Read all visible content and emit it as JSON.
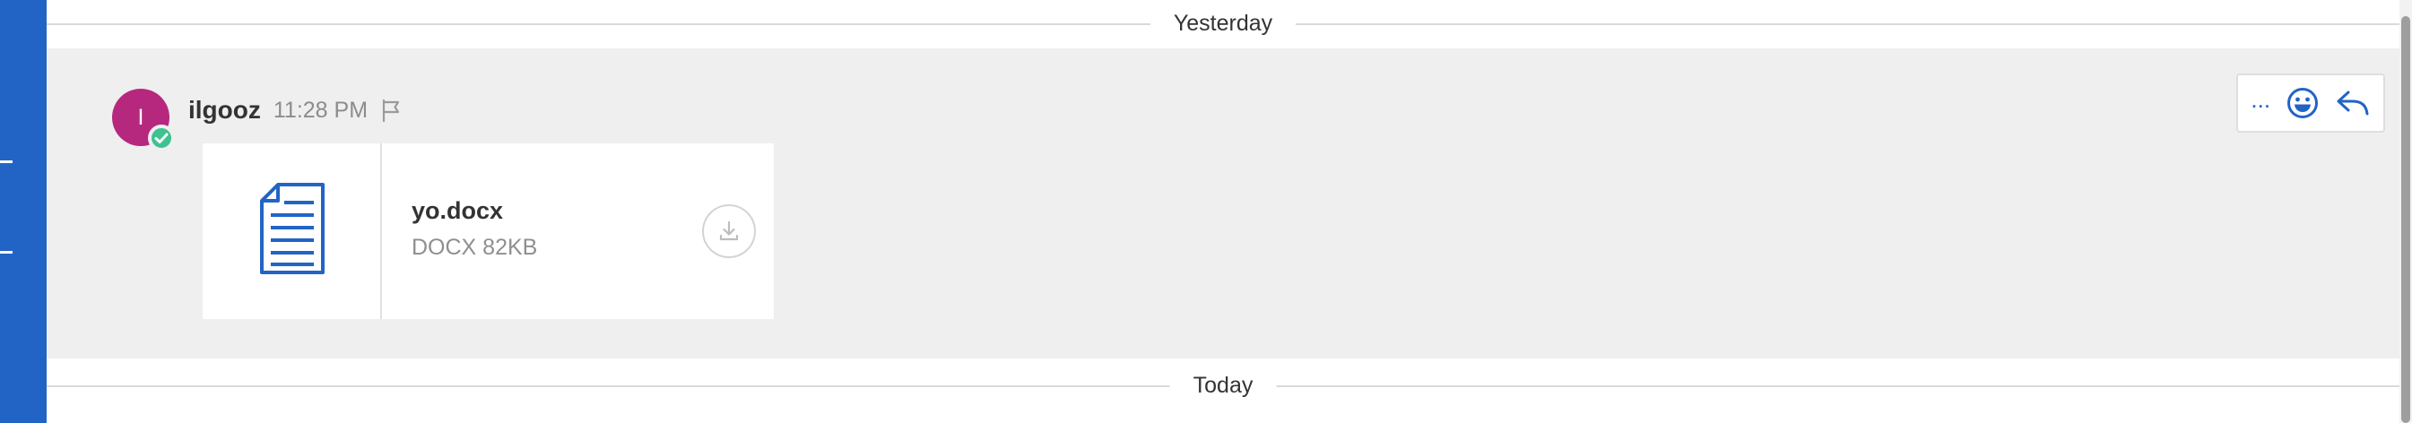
{
  "separators": {
    "yesterday": "Yesterday",
    "today": "Today"
  },
  "message": {
    "avatar_initial": "I",
    "author": "ilgooz",
    "time": "11:28 PM",
    "attachment": {
      "filename": "yo.docx",
      "meta": "DOCX 82KB"
    },
    "actions": {
      "more_label": "..."
    }
  },
  "colors": {
    "accent": "#2264c5",
    "avatar": "#b6287d",
    "online": "#3ec28f",
    "message_bg": "#efefef"
  },
  "icons": [
    "flag-icon",
    "document-icon",
    "download-icon",
    "emoji-icon",
    "reply-icon",
    "check-icon"
  ]
}
